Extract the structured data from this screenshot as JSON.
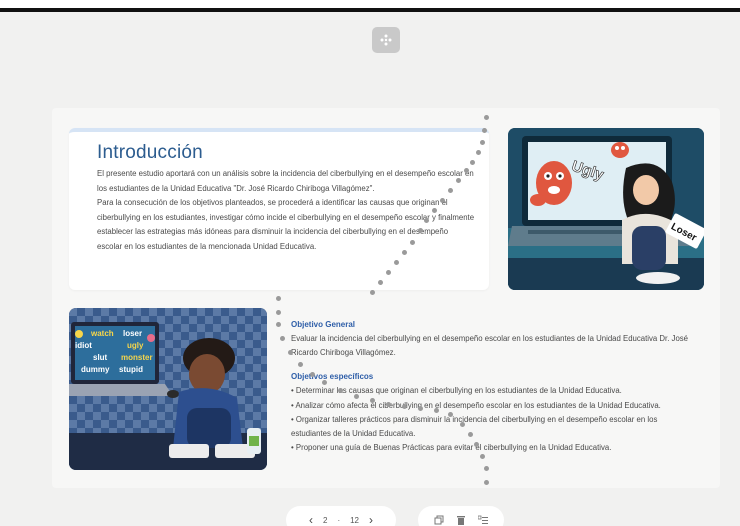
{
  "intro": {
    "title": "Introducción",
    "body": "El presente estudio aportará con un análisis sobre la incidencia del ciberbullying en el desempeño escolar en los estudiantes de la Unidad Educativa \"Dr. José Ricardo Chiriboga Villagómez\".\n Para la consecución de los objetivos planteados, se procederá a identificar las causas que originan el ciberbullying en los estudiantes, investigar cómo incide el ciberbullying en el desempeño escolar y finalmente establecer las estrategias más idóneas para disminuir la incidencia del ciberbullying en el desempeño escolar en los estudiantes de la mencionada Unidad Educativa."
  },
  "images": {
    "girl_words": [
      "Ugly",
      "Loser"
    ],
    "boy_words": [
      "watch",
      "loser",
      "idiot",
      "ugly",
      "slut",
      "monster",
      "dummy",
      "stupid"
    ]
  },
  "objectives": {
    "general_heading": "Objetivo General",
    "general_text": "Evaluar la incidencia del ciberbullying en el desempeño escolar en los estudiantes de la Unidad Educativa Dr. José Ricardo Chiriboga Villagómez.",
    "specific_heading": "Objetivos específicos",
    "specific_items": [
      "• Determinar las causas que originan el ciberbullying en los estudiantes de la Unidad Educativa.",
      "• Analizar cómo afecta el ciberbullying en el desempeño escolar en los estudiantes de la Unidad Educativa.",
      "• Organizar talleres prácticos para disminuir la incidencia del ciberbullying en el desempeño escolar en los estudiantes de la Unidad Educativa.",
      "• Proponer una guía de Buenas Prácticas para evitar el ciberbullying en la Unidad Educativa."
    ]
  },
  "pager": {
    "prev": "‹",
    "current": "2",
    "separator": "·",
    "total": "12",
    "next": "›"
  },
  "icons": {
    "dice": "dice-icon",
    "copy": "copy-icon",
    "delete": "trash-icon",
    "layout": "layout-list-icon"
  },
  "colors": {
    "title": "#2c5c8f",
    "heading": "#2e5ea8",
    "background": "#f1f1f0"
  }
}
